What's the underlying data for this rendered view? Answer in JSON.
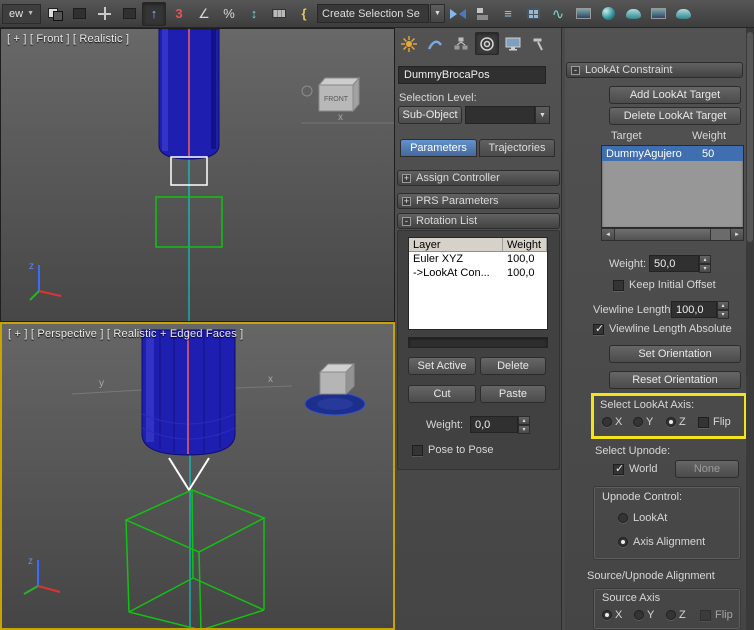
{
  "toolbar": {
    "menu_text": "ew",
    "selection_set_combo": "Create Selection Se",
    "icon_glyphs": {
      "select_arrow": "↑",
      "snap_3d": "3",
      "angle_snap": "∠",
      "percent_snap": "%",
      "spinner_snap": "↕",
      "named_sel_edit": "{",
      "layer_manager": "≡",
      "curve_editor": "∿"
    }
  },
  "viewports": {
    "front": {
      "label": "[ + ]  [ Front ]  [ Realistic ]",
      "gizmo_text": "FRONT",
      "axis_x": "x",
      "axis_z": "z"
    },
    "perspective": {
      "label": "[ + ]  [ Perspective ]  [ Realistic + Edged Faces ]",
      "axis_x": "x",
      "axis_y": "y",
      "axis_z": "z"
    }
  },
  "command_panel": {
    "object_name": "DummyBrocaPos",
    "selection_level_label": "Selection Level:",
    "sub_object_button": "Sub-Object",
    "tabs": {
      "parameters": "Parameters",
      "trajectories": "Trajectories"
    },
    "rollouts": {
      "assign_controller": {
        "symbol": "+",
        "label": "Assign Controller"
      },
      "prs_parameters": {
        "symbol": "+",
        "label": "PRS Parameters"
      },
      "rotation_list": {
        "symbol": "-",
        "label": "Rotation List"
      }
    },
    "rotation_list": {
      "col_layer": "Layer",
      "col_weight": "Weight",
      "rows": [
        {
          "layer": "Euler XYZ",
          "weight": "100,0"
        },
        {
          "layer": "->LookAt Con...",
          "weight": "100,0"
        }
      ],
      "set_active": "Set Active",
      "delete": "Delete",
      "cut": "Cut",
      "paste": "Paste",
      "weight_label": "Weight:",
      "weight_value": "0,0",
      "pose_to_pose": "Pose to Pose"
    }
  },
  "lookat": {
    "rollout_symbol": "-",
    "title": "LookAt Constraint",
    "add_target": "Add LookAt Target",
    "delete_target": "Delete LookAt Target",
    "col_target": "Target",
    "col_weight": "Weight",
    "target_rows": [
      {
        "name": "DummyAgujero",
        "weight": "50"
      }
    ],
    "weight_label": "Weight:",
    "weight_value": "50,0",
    "keep_initial_offset": "Keep Initial Offset",
    "viewline_length_label": "Viewline Length",
    "viewline_length_value": "100,0",
    "viewline_absolute": "Viewline Length Absolute",
    "set_orientation": "Set Orientation",
    "reset_orientation": "Reset Orientation",
    "axis_group": {
      "label": "Select LookAt Axis:",
      "x": "X",
      "y": "Y",
      "z": "Z",
      "flip": "Flip"
    },
    "upnode": {
      "label": "Select Upnode:",
      "world": "World",
      "none": "None"
    },
    "upnode_control": {
      "label": "Upnode Control:",
      "lookat": "LookAt",
      "axis_alignment": "Axis Alignment"
    },
    "alignment_header": "Source/Upnode Alignment",
    "source_axis": {
      "label": "Source Axis",
      "x": "X",
      "y": "Y",
      "z": "Z",
      "flip": "Flip"
    }
  }
}
